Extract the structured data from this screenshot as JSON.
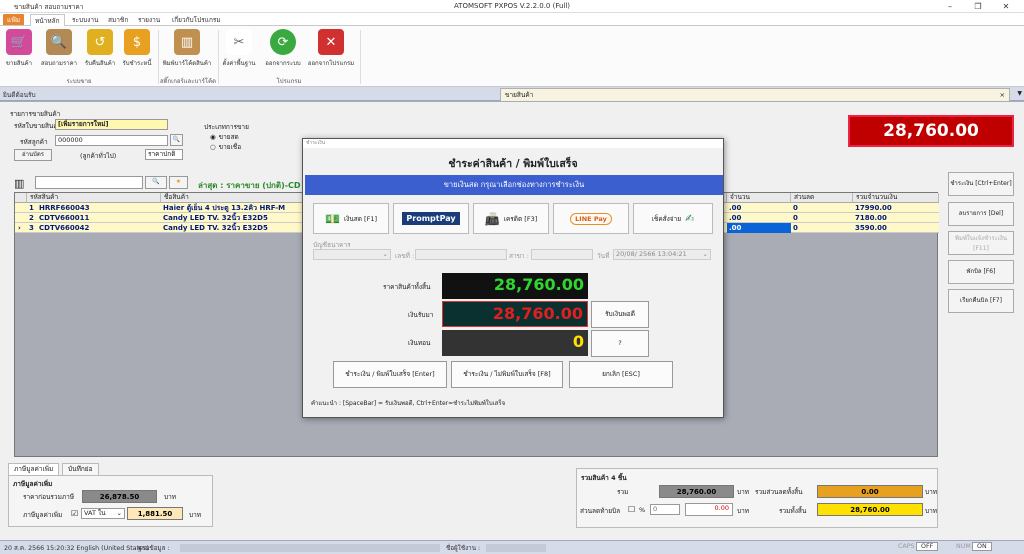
{
  "titlebar": {
    "quick_access": "ขายสินค้า  สอบถามราคา",
    "title": "ATOMSOFT PXPOS V.2.2.0.0 (Full)"
  },
  "ribbon_tabs": [
    "แฟ้ม",
    "หน้าหลัก",
    "ระบบงาน",
    "สมาชิก",
    "รายงาน",
    "เกี่ยวกับโปรแกรม"
  ],
  "ribbon": {
    "buttons": [
      {
        "label": "ขายสินค้า",
        "icon": "cart-icon",
        "color": "#d44a9a"
      },
      {
        "label": "สอบถามราคา",
        "icon": "search-person-icon",
        "color": "#b38a55"
      },
      {
        "label": "รับคืนสินค้า",
        "icon": "return-icon",
        "color": "#e0b020"
      },
      {
        "label": "รับชำระหนี้",
        "icon": "payment-icon",
        "color": "#e8a020"
      },
      {
        "label": "พิมพ์บาร์โค้ดสินค้า",
        "icon": "barcode-box-icon",
        "color": "#c09050"
      },
      {
        "label": "ตั้งค่าพื้นฐาน",
        "icon": "tools-icon",
        "color": "#888888"
      },
      {
        "label": "ออกจากระบบ",
        "icon": "logout-icon",
        "color": "#3aaa40"
      },
      {
        "label": "ออกจากโปรแกรม",
        "icon": "close-program-icon",
        "color": "#d03030"
      }
    ],
    "groups": [
      "ระบบขาย",
      "สติ๊กเกอร์และบาร์โค้ด",
      "โปรแกรม"
    ]
  },
  "doc_tabs": {
    "left": "ยินดีต้อนรับ",
    "active": "ขายสินค้า"
  },
  "sale": {
    "section_title": "รายการขายสินค้า",
    "sale_no_label": "รหัสใบขายสินค้า",
    "sale_no_value": "[เพิ่มรายการใหม่]",
    "customer_label": "รหัสลูกค้า",
    "customer_value": "000000",
    "id_card_button": "อ่านบัตร",
    "customer_type": "(ลูกค้าทั่วไป)",
    "price_level": "ราคาปกติ",
    "sale_type_label": "ประเภทการขาย",
    "sale_type_options": [
      "ขายสด",
      "ขายเชื่อ"
    ],
    "total_display": "28,760.00",
    "latest_label": "ล่าสุด : ราคาขาย (ปกติ)-CD"
  },
  "grid": {
    "headers": [
      "รหัสสินค้า",
      "ชื่อสินค้า",
      "จำนวน",
      "ส่วนลด",
      "รวมจำนวนเงิน"
    ],
    "rows": [
      {
        "no": "1",
        "code": "HRRF660043",
        "name": "Haier ตู้เย็น 4 ประตู 13.2คิว  HRF-M",
        "qty": ".00",
        "discount": "0",
        "total": "17990.00"
      },
      {
        "no": "2",
        "code": "CDTV660011",
        "name": "Candy LED TV. 32นิ้ว  E32D5",
        "qty": ".00",
        "discount": "0",
        "total": "7180.00"
      },
      {
        "no": "3",
        "code": "CDTV660042",
        "name": "Candy LED TV. 32นิ้ว  E32D5",
        "qty": ".00",
        "discount": "0",
        "total": "3590.00"
      }
    ]
  },
  "right_buttons": [
    {
      "label": "ชำระเงิน [Ctrl+Enter]"
    },
    {
      "label": "ลบรายการ [Del]"
    },
    {
      "label": "พิมพ์ใบแจ้งชำระเงิน [F11]"
    },
    {
      "label": "พักบิล [F6]"
    },
    {
      "label": "เรียกคืนบิล [F7]"
    }
  ],
  "bottom_tabs": [
    "ภาษีมูลค่าเพิ่ม",
    "บันทึกย่อ"
  ],
  "vat": {
    "group_title": "ภาษีมูลค่าเพิ่ม",
    "before_vat_label": "ราคาก่อนรวมภาษี",
    "before_vat_value": "26,878.50",
    "vat_label": "ภาษีมูลค่าเพิ่ม",
    "vat_type": "VAT ใน",
    "vat_value": "1,881.50",
    "unit": "บาท"
  },
  "summary": {
    "title": "รวมสินค้า 4 ชิ้น",
    "sum_label": "รวม",
    "sum_value": "28,760.00",
    "discount_total_label": "รวมส่วนลดทั้งสิ้น",
    "discount_total_value": "0.00",
    "end_discount_label": "ส่วนลดท้ายบิล",
    "percent_sign": "%",
    "end_discount_pct": "0",
    "end_discount_value": "0.00",
    "grand_total_label": "รวมทั้งสิ้น",
    "grand_total_value": "28,760.00",
    "unit": "บาท"
  },
  "modal": {
    "window_title": "ชำระเงิน",
    "heading": "ชำระค่าสินค้า / พิมพ์ใบเสร็จ",
    "banner": "ขายเงินสด กรุณาเลือกช่องทางการชำระเงิน",
    "pay_methods": [
      "เงินสด [F1]",
      "PromptPay",
      "เครดิต [F3]",
      "LINE Pay",
      "เช็คสั่งจ่าย"
    ],
    "bank_label": "บัญชีธนาคาร",
    "number_label": "เลขที่ :",
    "branch_label": "สาขา :",
    "date_label": "วันที่",
    "date_value": "20/08/ 2566 13:04:21",
    "total_label": "ราคาสินค้าทั้งสิ้น",
    "total_value": "28,760.00",
    "received_label": "เงินรับมา",
    "received_value": "28,760.00",
    "exact_button": "รับเงินพอดี",
    "change_label": "เงินทอน",
    "change_value": "0",
    "help_button": "?",
    "pay_print_button": "ชำระเงิน / พิมพ์ใบเสร็จ [Enter]",
    "pay_noprint_button": "ชำระเงิน / ไม่พิมพ์ใบเสร็จ [F8]",
    "cancel_button": "ยกเลิก [ESC]",
    "hint": "คำแนะนำ : [SpaceBar] = รับเงินพอดี,  Ctrl+Enter=ชำระไม่พิมพ์ใบเสร็จ"
  },
  "status": {
    "datetime": "20 ส.ค. 2566 15:20:32 English (United States)",
    "db_label": "ฐานข้อมูล :",
    "user_label": "ชื่อผู้ใช้งาน :",
    "caps": "CAPS",
    "caps_state": "OFF",
    "num": "NUM",
    "num_state": "ON"
  }
}
